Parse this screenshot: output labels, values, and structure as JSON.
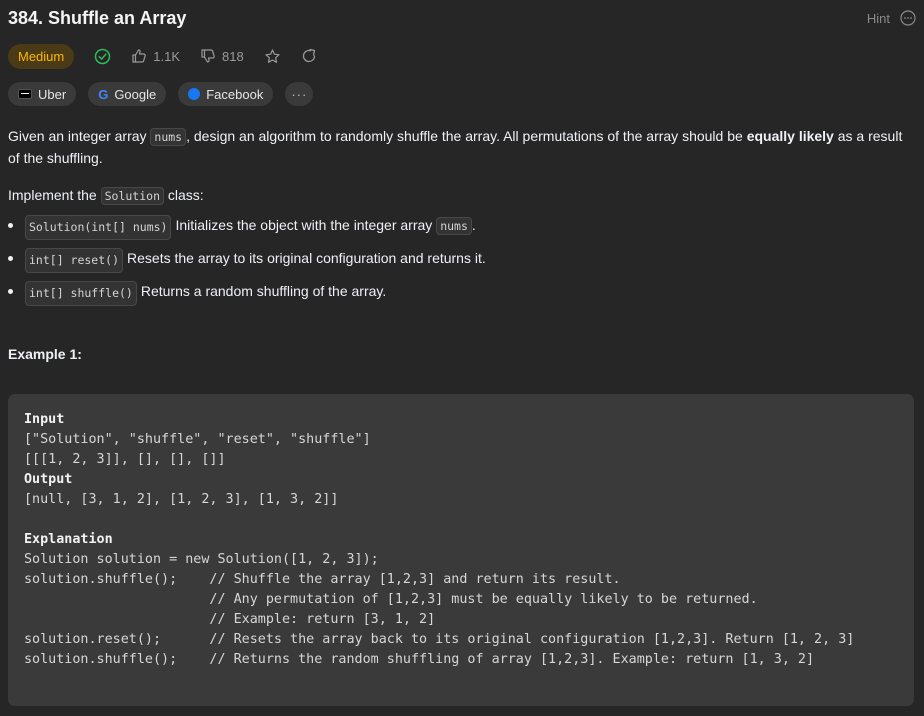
{
  "header": {
    "title": "384. Shuffle an Array",
    "hint_label": "Hint"
  },
  "meta": {
    "difficulty": "Medium",
    "likes": "1.1K",
    "dislikes": "818"
  },
  "companies": [
    {
      "name": "Uber"
    },
    {
      "name": "Google"
    },
    {
      "name": "Facebook"
    }
  ],
  "companies_more": "···",
  "description": {
    "p1_a": "Given an integer array ",
    "p1_code": "nums",
    "p1_b": ", design an algorithm to randomly shuffle the array. All permutations of the array should be ",
    "p1_bold": "equally likely",
    "p1_c": " as a result of the shuffling.",
    "p2_a": "Implement the ",
    "p2_code": "Solution",
    "p2_b": " class:",
    "bullets": [
      {
        "code": "Solution(int[] nums)",
        "text": "Initializes the object with the integer array ",
        "code2": "nums",
        "tail": "."
      },
      {
        "code": "int[] reset()",
        "text": "Resets the array to its original configuration and returns it."
      },
      {
        "code": "int[] shuffle()",
        "text": "Returns a random shuffling of the array."
      }
    ]
  },
  "example": {
    "heading": "Example 1:",
    "input_label": "Input",
    "input_line1": "[\"Solution\", \"shuffle\", \"reset\", \"shuffle\"]",
    "input_line2": "[[[1, 2, 3]], [], [], []]",
    "output_label": "Output",
    "output_line1": "[null, [3, 1, 2], [1, 2, 3], [1, 3, 2]]",
    "explanation_label": "Explanation",
    "explanation_lines": [
      "Solution solution = new Solution([1, 2, 3]);",
      "solution.shuffle();    // Shuffle the array [1,2,3] and return its result.",
      "                       // Any permutation of [1,2,3] must be equally likely to be returned.",
      "                       // Example: return [3, 1, 2]",
      "solution.reset();      // Resets the array back to its original configuration [1,2,3]. Return [1, 2, 3]",
      "solution.shuffle();    // Returns the random shuffling of array [1,2,3]. Example: return [1, 3, 2]"
    ]
  },
  "colors": {
    "background": "#262626",
    "medium_badge_bg": "#4a3b16",
    "medium_badge_text": "#ffb800",
    "solved_check": "#2cbb5d",
    "code_block_bg": "#3a3a3a"
  }
}
